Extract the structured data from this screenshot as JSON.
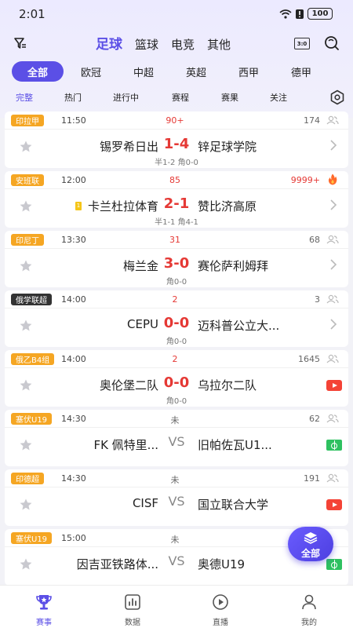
{
  "status": {
    "time": "2:01",
    "battery": "100"
  },
  "nav": {
    "tabs": [
      "足球",
      "篮球",
      "电竞",
      "其他"
    ],
    "score_icon_text": "3:0"
  },
  "leagues": [
    "全部",
    "欧冠",
    "中超",
    "英超",
    "西甲",
    "德甲"
  ],
  "filters": [
    "完整",
    "热门",
    "进行中",
    "赛程",
    "赛果",
    "关注"
  ],
  "matches": [
    {
      "league": "印拉甲",
      "time": "11:50",
      "minute": "90+",
      "count": "174",
      "home": "锡罗希日出",
      "score": "1-4",
      "away": "锌足球学院",
      "sub": "半1-2 角0-0"
    },
    {
      "league": "安班联",
      "time": "12:00",
      "minute": "85",
      "count": "9999+",
      "home": "卡兰杜拉体育",
      "home_card": "1",
      "score": "2-1",
      "away": "赞比济高原",
      "sub": "半1-1 角4-1"
    },
    {
      "league": "印尼丁",
      "time": "13:30",
      "minute": "31",
      "count": "68",
      "home": "梅兰金",
      "score": "3-0",
      "away": "赛伦萨利姆拜",
      "sub": "角0-0"
    },
    {
      "league": "俄学联超",
      "time": "14:00",
      "minute": "2",
      "count": "3",
      "home": "CEPU",
      "score": "0-0",
      "away": "迈科普公立大...",
      "sub": "角0-0"
    },
    {
      "league": "俄乙B4组",
      "time": "14:00",
      "minute": "2",
      "count": "1645",
      "home": "奥伦堡二队",
      "score": "0-0",
      "away": "乌拉尔二队",
      "sub": "角0-0"
    },
    {
      "league": "塞伏U19",
      "time": "14:30",
      "minute": "未",
      "count": "62",
      "home": "FK 佩特里...",
      "score": "VS",
      "away": "旧帕佐瓦U1..."
    },
    {
      "league": "印德超",
      "time": "14:30",
      "minute": "未",
      "count": "191",
      "home": "CISF",
      "score": "VS",
      "away": "国立联合大学"
    },
    {
      "league": "塞伏U19",
      "time": "15:00",
      "minute": "未",
      "home": "因吉亚铁路体...",
      "score": "VS",
      "away": "奥德U19"
    }
  ],
  "fab_label": "全部",
  "tabbar": [
    "赛事",
    "数据",
    "直播",
    "我的"
  ],
  "colors": {
    "accent": "#5b4fe6",
    "live_red": "#e53935",
    "tag_orange": "#f5a623"
  }
}
